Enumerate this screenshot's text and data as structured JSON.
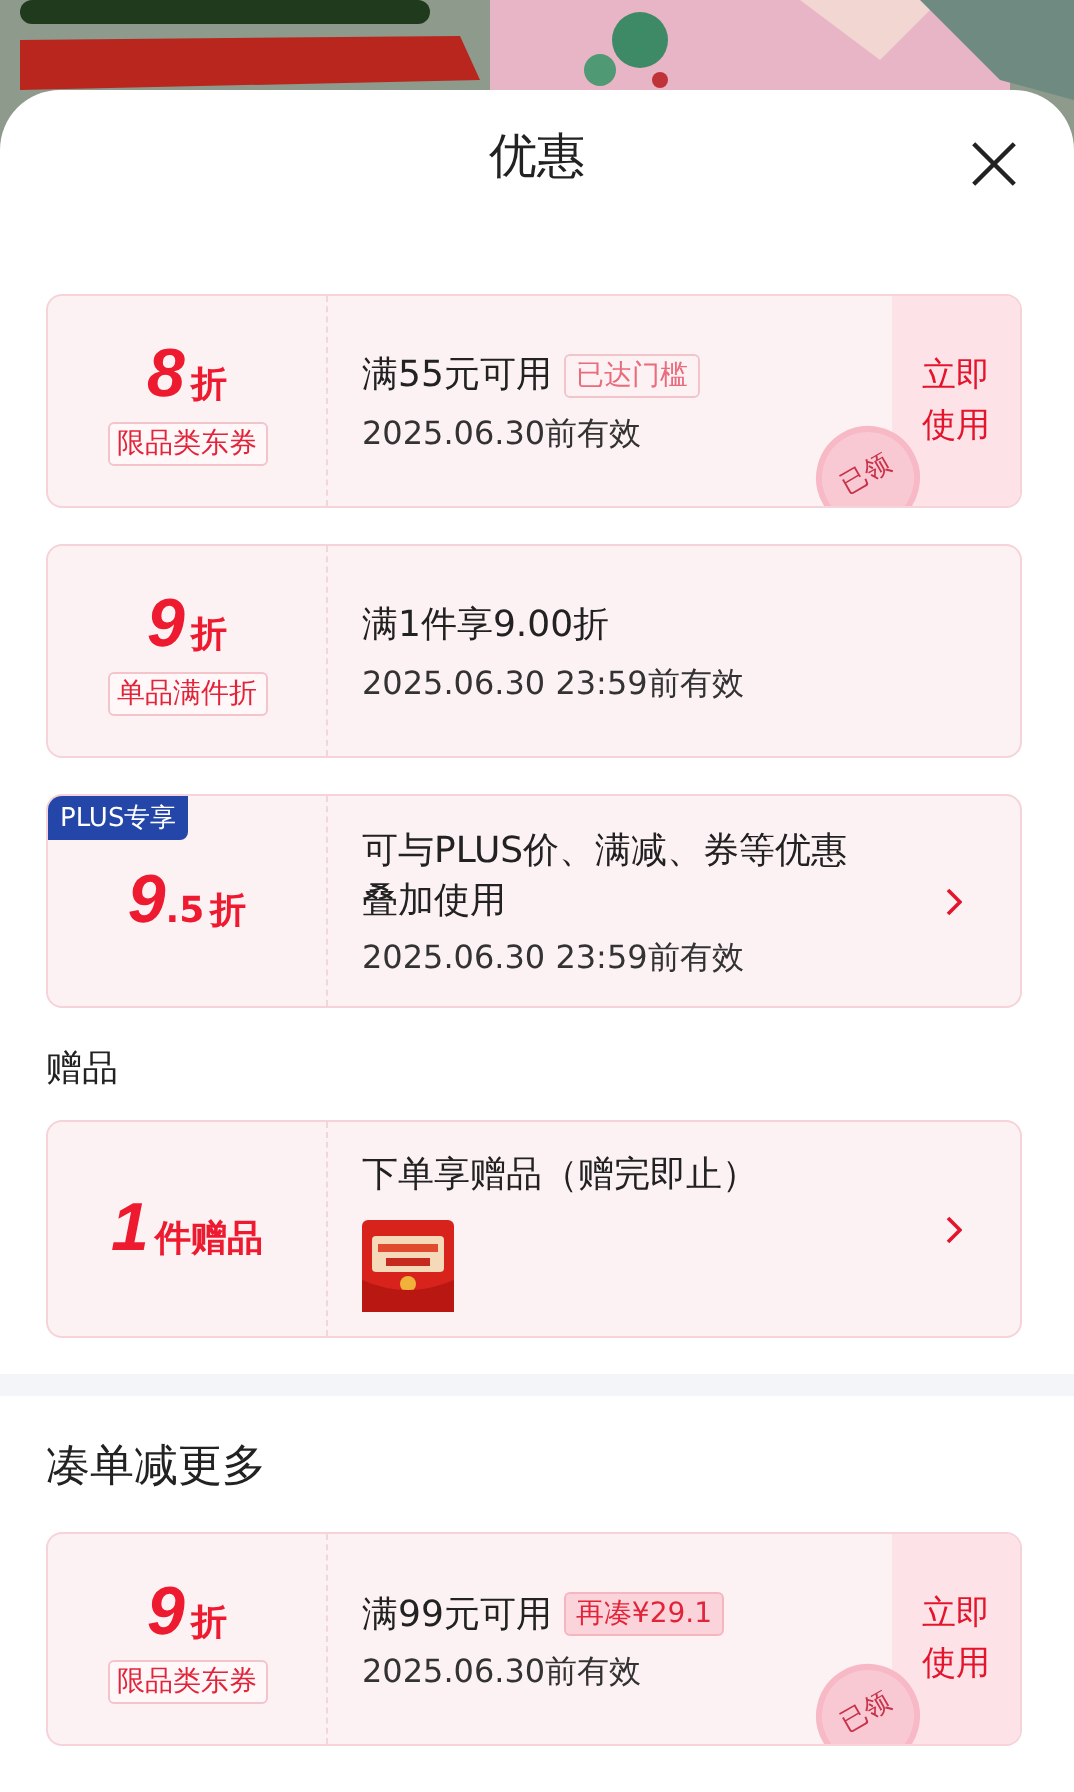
{
  "sheet": {
    "title": "优惠"
  },
  "sections": [
    {
      "kind": "group",
      "cards": [
        {
          "value": "8",
          "unit": "折",
          "tag": "限品类东券",
          "title": "满55元可用",
          "badge": {
            "text": "已达门槛",
            "kind": "outline"
          },
          "validity": "2025.06.30前有效",
          "action": {
            "kind": "button",
            "label": "立即使用"
          },
          "stamp": "已领"
        },
        {
          "value": "9",
          "unit": "折",
          "tag": "单品满件折",
          "title": "满1件享9.00折",
          "validity": "2025.06.30 23:59前有效"
        },
        {
          "plus_tag": "PLUS专享",
          "value": "9",
          "decimal": ".5",
          "unit": "折",
          "title": "可与PLUS价、满减、券等优惠叠加使用",
          "validity": "2025.06.30 23:59前有效",
          "action": {
            "kind": "chevron"
          }
        }
      ]
    },
    {
      "kind": "group",
      "heading": "赠品",
      "cards": [
        {
          "value": "1",
          "unit": "件赠品",
          "title": "下单享赠品（赠完即止）",
          "action": {
            "kind": "chevron"
          }
        }
      ]
    },
    {
      "kind": "divider"
    },
    {
      "kind": "promo",
      "heading": "凑单减更多",
      "cards": [
        {
          "value": "9",
          "unit": "折",
          "tag": "限品类东券",
          "title": "满99元可用",
          "badge": {
            "text": "再凑¥29.1",
            "kind": "filled"
          },
          "validity": "2025.06.30前有效",
          "action": {
            "kind": "button",
            "label": "立即使用"
          },
          "stamp": "已领"
        }
      ]
    }
  ]
}
